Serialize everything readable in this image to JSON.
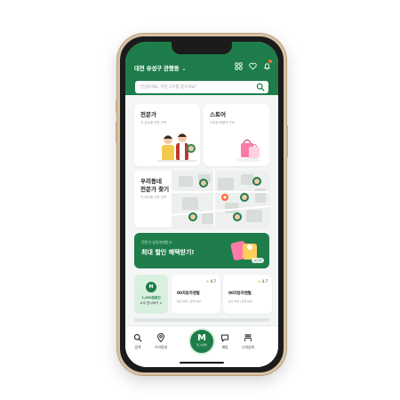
{
  "header": {
    "location_label": "대전 유성구 관평동",
    "icons": [
      "chevron-down-icon",
      "grid-icon",
      "heart-icon",
      "bell-icon"
    ],
    "search_placeholder": "안녕하세요, 어떤 고수를 찾으세요?"
  },
  "cards": {
    "expert": {
      "title": "전문가",
      "subtitle": "각 분야별 전문 인력"
    },
    "store": {
      "title": "스토어",
      "subtitle": "다양한 제품의 가득"
    },
    "local": {
      "title_line1": "우리동네",
      "title_line2": "전문가 찾기",
      "subtitle": "각 분야별 전문 인력"
    }
  },
  "banner": {
    "small_text": "전문가 상담의뢰받고",
    "big_text": "최대 할인 혜택받기!",
    "page_indicator": "1 / 5"
  },
  "promo": {
    "logo_text": "M",
    "line1": "1,000원할인",
    "line2": "고수 만나보기 >"
  },
  "experts": [
    {
      "rating": "4.7",
      "name": "00자동차렌털",
      "info": "상담 00건 | 경력 00년"
    },
    {
      "rating": "4.7",
      "name": "00자동차렌털",
      "info": "상담 00건 | 경력 00년"
    }
  ],
  "nav": {
    "items": [
      {
        "label": "검색",
        "icon": "search-icon"
      },
      {
        "label": "우리동네",
        "icon": "map-pin-icon"
      },
      {
        "label": "망고니메리",
        "icon": "logo-icon"
      },
      {
        "label": "채팅",
        "icon": "chat-icon"
      },
      {
        "label": "나의상위",
        "icon": "profile-icon"
      }
    ]
  },
  "colors": {
    "brand_green": "#1e7d4a",
    "accent_orange": "#ff6b3d",
    "star": "#f5b400"
  }
}
